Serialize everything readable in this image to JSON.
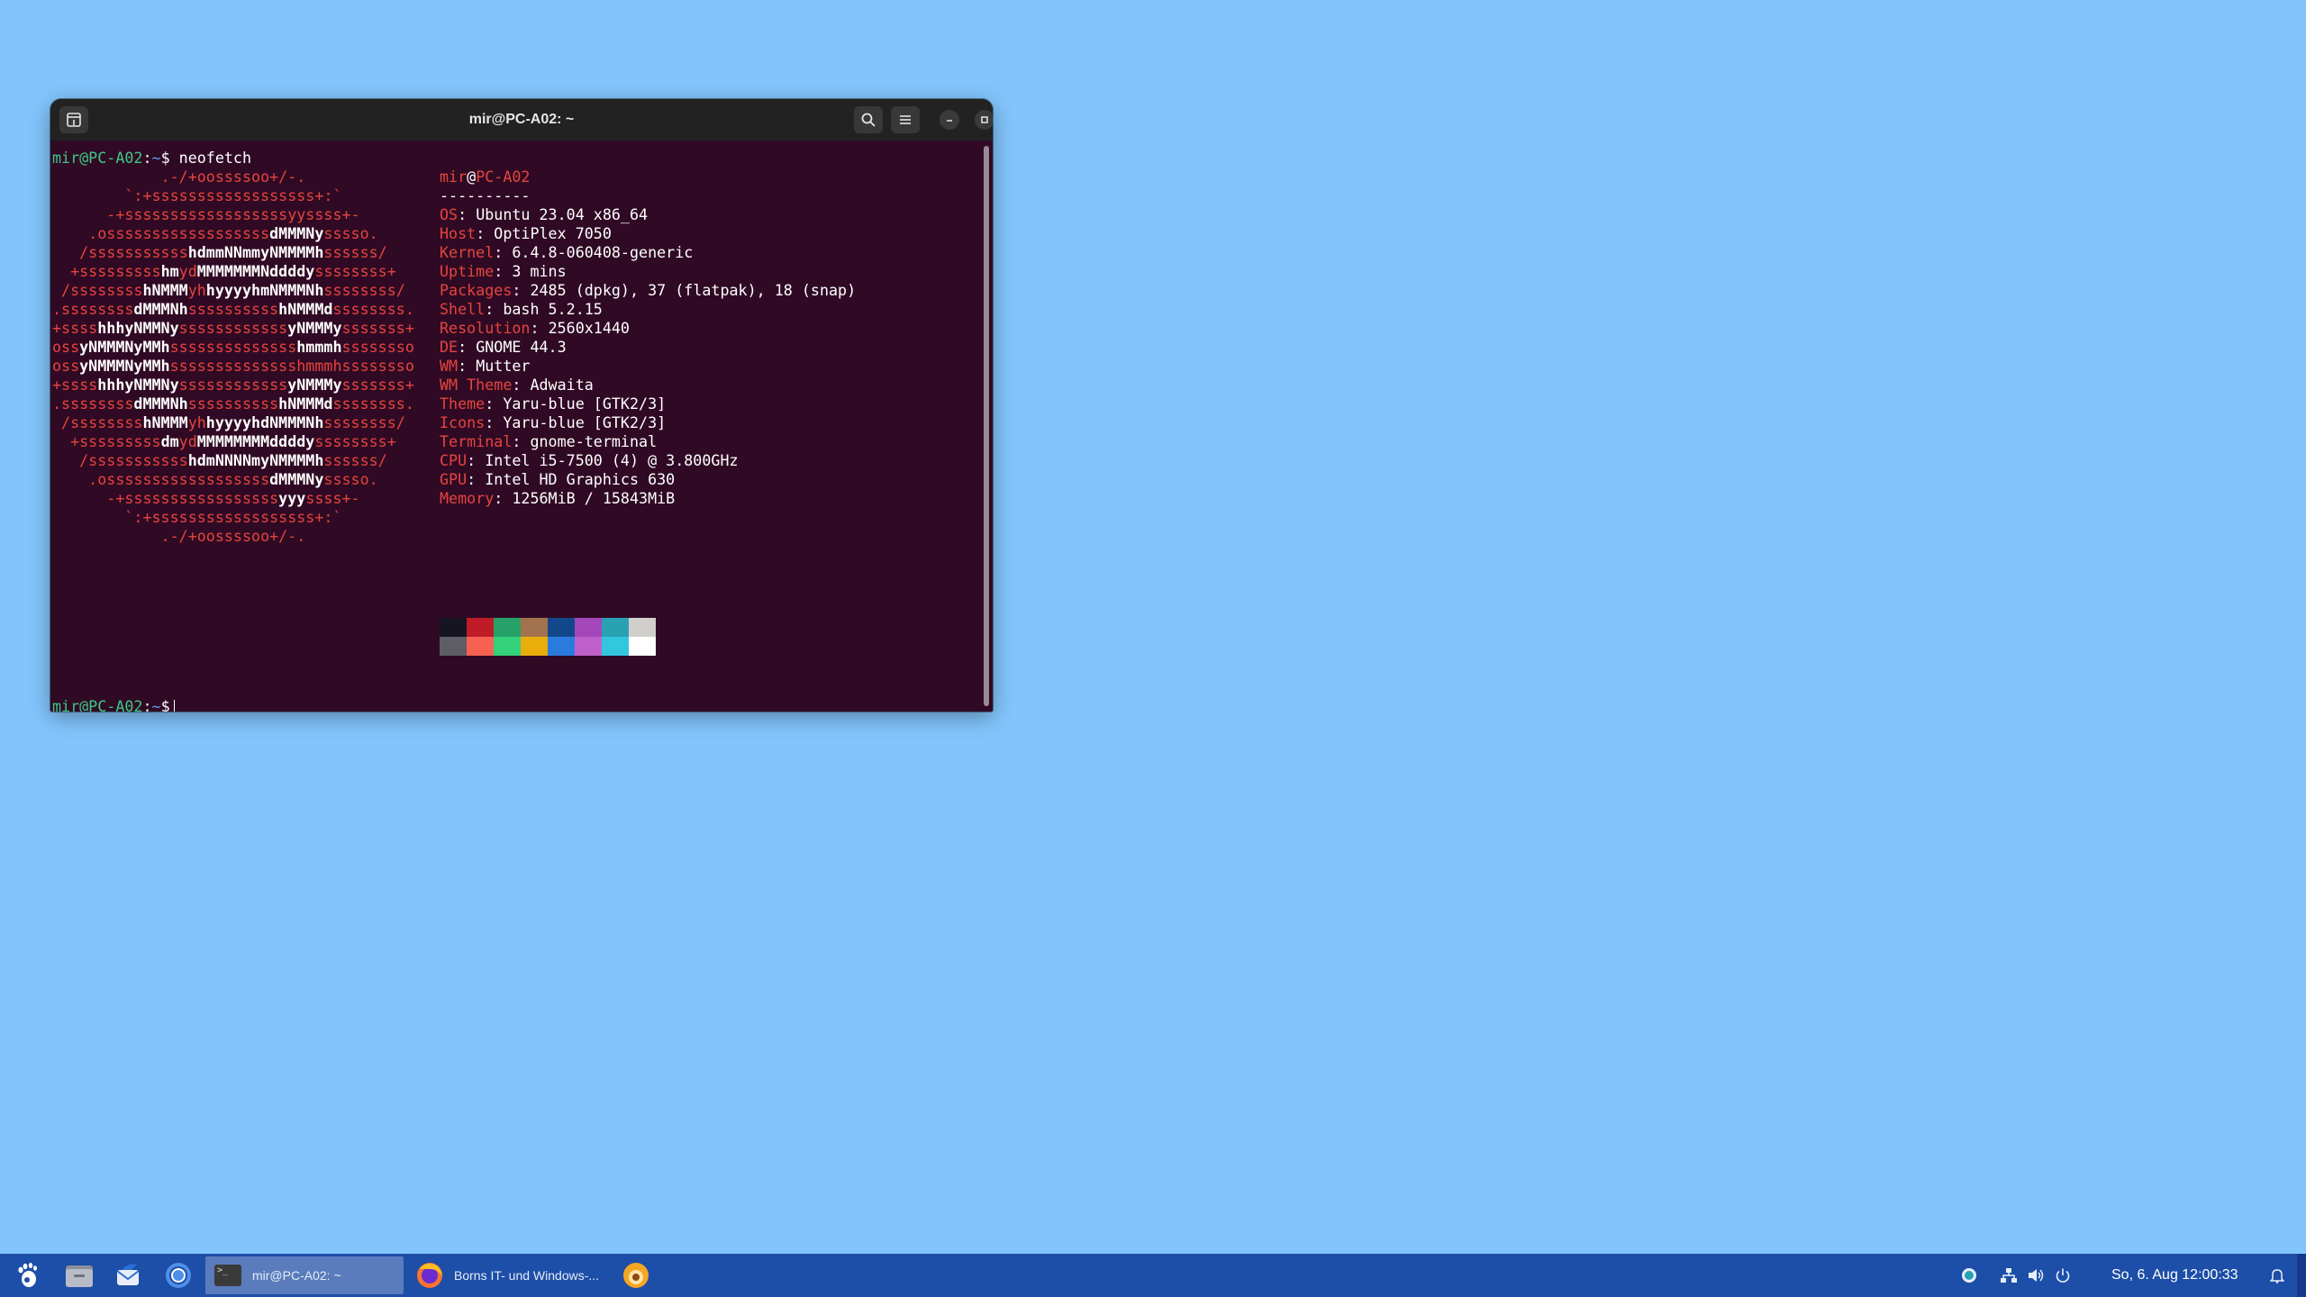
{
  "desktop": {
    "background": "#82c5fc"
  },
  "terminal": {
    "title": "mir@PC-A02: ~",
    "prompt_user_host": "mir@PC-A02",
    "prompt_sep": ":",
    "prompt_path": "~",
    "prompt_symbol": "$",
    "command": " neofetch",
    "logo": [
      [
        [
          "r",
          "            .-/+oossssoo+/-."
        ]
      ],
      [
        [
          "r",
          "        `:+ssssssssssssssssss+:`"
        ]
      ],
      [
        [
          "r",
          "      -+ssssssssssssssssssyyssss+-"
        ]
      ],
      [
        [
          "r",
          "    .ossssssssssssssssss"
        ],
        [
          "w",
          "dMMMNy"
        ],
        [
          "r",
          "sssso."
        ]
      ],
      [
        [
          "r",
          "   /sssssssssss"
        ],
        [
          "w",
          "hdmmNNmmyNMMMMh"
        ],
        [
          "r",
          "ssssss/"
        ]
      ],
      [
        [
          "r",
          "  +sssssssss"
        ],
        [
          "w",
          "hm"
        ],
        [
          "r",
          "yd"
        ],
        [
          "w",
          "MMMMMMMNddddy"
        ],
        [
          "r",
          "ssssssss+"
        ]
      ],
      [
        [
          "r",
          " /ssssssss"
        ],
        [
          "w",
          "hNMMM"
        ],
        [
          "r",
          "yh"
        ],
        [
          "w",
          "hyyyyhmNMMMNh"
        ],
        [
          "r",
          "ssssssss/"
        ]
      ],
      [
        [
          "r",
          ".ssssssss"
        ],
        [
          "w",
          "dMMMNh"
        ],
        [
          "r",
          "ssssssssss"
        ],
        [
          "w",
          "hNMMMd"
        ],
        [
          "r",
          "ssssssss."
        ]
      ],
      [
        [
          "r",
          "+ssss"
        ],
        [
          "w",
          "hhhyNMMNy"
        ],
        [
          "r",
          "ssssssssssss"
        ],
        [
          "w",
          "yNMMMy"
        ],
        [
          "r",
          "sssssss+"
        ]
      ],
      [
        [
          "r",
          "oss"
        ],
        [
          "w",
          "yNMMMNyMMh"
        ],
        [
          "r",
          "ssssssssssssss"
        ],
        [
          "w",
          "hmmmh"
        ],
        [
          "r",
          "ssssssso"
        ]
      ],
      [
        [
          "r",
          "oss"
        ],
        [
          "w",
          "yNMMMNyMMh"
        ],
        [
          "r",
          "sssssssssssssshmmmhssssssso"
        ]
      ],
      [
        [
          "r",
          "+ssss"
        ],
        [
          "w",
          "hhhyNMMNy"
        ],
        [
          "r",
          "ssssssssssss"
        ],
        [
          "w",
          "yNMMMy"
        ],
        [
          "r",
          "sssssss+"
        ]
      ],
      [
        [
          "r",
          ".ssssssss"
        ],
        [
          "w",
          "dMMMNh"
        ],
        [
          "r",
          "ssssssssss"
        ],
        [
          "w",
          "hNMMMd"
        ],
        [
          "r",
          "ssssssss."
        ]
      ],
      [
        [
          "r",
          " /ssssssss"
        ],
        [
          "w",
          "hNMMM"
        ],
        [
          "r",
          "yh"
        ],
        [
          "w",
          "hyyyyhdNMMMNh"
        ],
        [
          "r",
          "ssssssss/"
        ]
      ],
      [
        [
          "r",
          "  +sssssssss"
        ],
        [
          "w",
          "dm"
        ],
        [
          "r",
          "yd"
        ],
        [
          "w",
          "MMMMMMMMddddy"
        ],
        [
          "r",
          "ssssssss+"
        ]
      ],
      [
        [
          "r",
          "   /sssssssssss"
        ],
        [
          "w",
          "hdmNNNNmyNMMMMh"
        ],
        [
          "r",
          "ssssss/"
        ]
      ],
      [
        [
          "r",
          "    .ossssssssssssssssss"
        ],
        [
          "w",
          "dMMMNy"
        ],
        [
          "r",
          "sssso."
        ]
      ],
      [
        [
          "r",
          "      -+sssssssssssssssss"
        ],
        [
          "w",
          "yyy"
        ],
        [
          "r",
          "ssss+-"
        ]
      ],
      [
        [
          "r",
          "        `:+ssssssssssssssssss+:`"
        ]
      ],
      [
        [
          "r",
          "            .-/+oossssoo+/-."
        ]
      ]
    ],
    "info": {
      "user": "mir",
      "at": "@",
      "host": "PC-A02",
      "separator": "----------",
      "rows": [
        {
          "label": "OS",
          "value": "Ubuntu 23.04 x86_64"
        },
        {
          "label": "Host",
          "value": "OptiPlex 7050"
        },
        {
          "label": "Kernel",
          "value": "6.4.8-060408-generic"
        },
        {
          "label": "Uptime",
          "value": "3 mins"
        },
        {
          "label": "Packages",
          "value": "2485 (dpkg), 37 (flatpak), 18 (snap)"
        },
        {
          "label": "Shell",
          "value": "bash 5.2.15"
        },
        {
          "label": "Resolution",
          "value": "2560x1440"
        },
        {
          "label": "DE",
          "value": "GNOME 44.3"
        },
        {
          "label": "WM",
          "value": "Mutter"
        },
        {
          "label": "WM Theme",
          "value": "Adwaita"
        },
        {
          "label": "Theme",
          "value": "Yaru-blue [GTK2/3]"
        },
        {
          "label": "Icons",
          "value": "Yaru-blue [GTK2/3]"
        },
        {
          "label": "Terminal",
          "value": "gnome-terminal"
        },
        {
          "label": "CPU",
          "value": "Intel i5-7500 (4) @ 3.800GHz"
        },
        {
          "label": "GPU",
          "value": "Intel HD Graphics 630"
        },
        {
          "label": "Memory",
          "value": "1256MiB / 15843MiB"
        }
      ],
      "label_sep": ": ",
      "palette": [
        [
          "#171421",
          "#c01c28",
          "#26a269",
          "#a2734c",
          "#12488b",
          "#a347ba",
          "#2aa1b3",
          "#d0cfcc"
        ],
        [
          "#5e5c64",
          "#f66151",
          "#33d17a",
          "#e9ad0c",
          "#2a7bde",
          "#c061cb",
          "#33c7de",
          "#ffffff"
        ]
      ]
    }
  },
  "taskbar": {
    "tasks": [
      {
        "label": "mir@PC-A02: ~",
        "icon": "terminal-icon"
      },
      {
        "label": "Borns IT- und Windows-...",
        "icon": "firefox-icon"
      }
    ],
    "clock": "So, 6. Aug  12:00:33",
    "tray_icons": [
      "update-icon",
      "network-icon",
      "volume-icon",
      "power-icon",
      "notification-bell-icon"
    ]
  }
}
